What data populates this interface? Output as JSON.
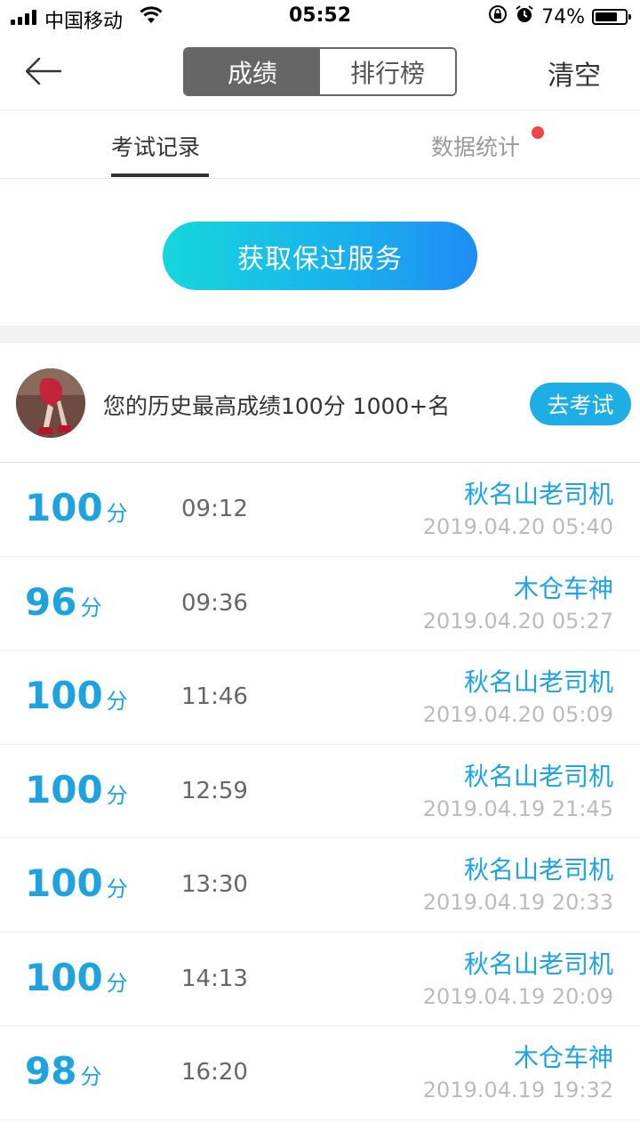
{
  "status_bar": {
    "carrier": "中国移动",
    "time": "05:52",
    "battery": "74%",
    "battery_level": 0.74
  },
  "header": {
    "back_icon": "arrow-left-icon",
    "segments": [
      {
        "label": "成绩",
        "active": true
      },
      {
        "label": "排行榜",
        "active": false
      }
    ],
    "clear_label": "清空"
  },
  "sub_tabs": [
    {
      "label": "考试记录",
      "active": true
    },
    {
      "label": "数据统计",
      "active": false,
      "badge": "red-dot"
    }
  ],
  "service_button": "获取保过服务",
  "best": {
    "text": "您的历史最高成绩100分  1000+名",
    "button": "去考试"
  },
  "records": [
    {
      "score": "100",
      "unit": "分",
      "duration": "09:12",
      "name": "秋名山老司机",
      "time": "2019.04.20 05:40"
    },
    {
      "score": "96",
      "unit": "分",
      "duration": "09:36",
      "name": "木仓车神",
      "time": "2019.04.20 05:27"
    },
    {
      "score": "100",
      "unit": "分",
      "duration": "11:46",
      "name": "秋名山老司机",
      "time": "2019.04.20 05:09"
    },
    {
      "score": "100",
      "unit": "分",
      "duration": "12:59",
      "name": "秋名山老司机",
      "time": "2019.04.19 21:45"
    },
    {
      "score": "100",
      "unit": "分",
      "duration": "13:30",
      "name": "秋名山老司机",
      "time": "2019.04.19 20:33"
    },
    {
      "score": "100",
      "unit": "分",
      "duration": "14:13",
      "name": "秋名山老司机",
      "time": "2019.04.19 20:09"
    },
    {
      "score": "98",
      "unit": "分",
      "duration": "16:20",
      "name": "木仓车神",
      "time": "2019.04.19 19:32"
    }
  ],
  "colors": {
    "accent": "#1fa3e0",
    "segment_active": "#666666",
    "badge": "#f24444"
  }
}
